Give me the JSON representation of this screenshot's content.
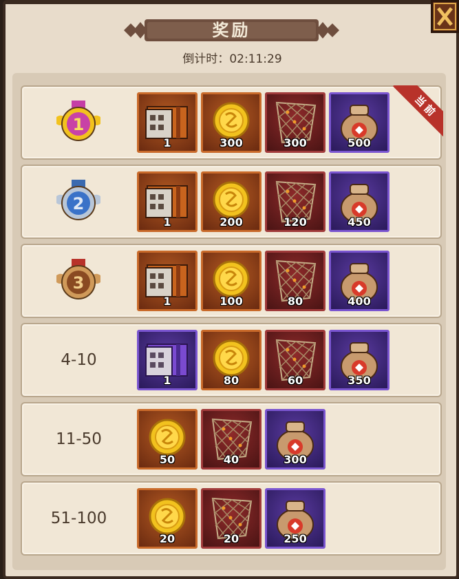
{
  "title": "奖励",
  "countdown": {
    "label": "倒计时：",
    "time": "02:11:29"
  },
  "current_badge": "当前",
  "rows": [
    {
      "rank_label": "",
      "medal": "gold-medal-1",
      "items": [
        {
          "icon": "treasure-chest-icon",
          "qty": "1",
          "frame": "orange"
        },
        {
          "icon": "gold-coin-icon",
          "qty": "300",
          "frame": "orange"
        },
        {
          "icon": "net-icon",
          "qty": "300",
          "frame": "red"
        },
        {
          "icon": "sack-icon",
          "qty": "500",
          "frame": "purple"
        }
      ]
    },
    {
      "rank_label": "",
      "medal": "silver-medal-2",
      "items": [
        {
          "icon": "treasure-chest-icon",
          "qty": "1",
          "frame": "orange"
        },
        {
          "icon": "gold-coin-icon",
          "qty": "200",
          "frame": "orange"
        },
        {
          "icon": "net-icon",
          "qty": "120",
          "frame": "red"
        },
        {
          "icon": "sack-icon",
          "qty": "450",
          "frame": "purple"
        }
      ]
    },
    {
      "rank_label": "",
      "medal": "bronze-medal-3",
      "items": [
        {
          "icon": "treasure-chest-icon",
          "qty": "1",
          "frame": "orange"
        },
        {
          "icon": "gold-coin-icon",
          "qty": "100",
          "frame": "orange"
        },
        {
          "icon": "net-icon",
          "qty": "80",
          "frame": "red"
        },
        {
          "icon": "sack-icon",
          "qty": "400",
          "frame": "purple"
        }
      ]
    },
    {
      "rank_label": "4-10",
      "medal": "",
      "items": [
        {
          "icon": "purple-chest-icon",
          "qty": "1",
          "frame": "purple"
        },
        {
          "icon": "gold-coin-icon",
          "qty": "80",
          "frame": "orange"
        },
        {
          "icon": "net-icon",
          "qty": "60",
          "frame": "red"
        },
        {
          "icon": "sack-icon",
          "qty": "350",
          "frame": "purple"
        }
      ]
    },
    {
      "rank_label": "11-50",
      "medal": "",
      "items": [
        {
          "icon": "gold-coin-icon",
          "qty": "50",
          "frame": "orange"
        },
        {
          "icon": "net-icon",
          "qty": "40",
          "frame": "red"
        },
        {
          "icon": "sack-icon",
          "qty": "300",
          "frame": "purple"
        }
      ]
    },
    {
      "rank_label": "51-100",
      "medal": "",
      "items": [
        {
          "icon": "gold-coin-icon",
          "qty": "20",
          "frame": "orange"
        },
        {
          "icon": "net-icon",
          "qty": "20",
          "frame": "red"
        },
        {
          "icon": "sack-icon",
          "qty": "250",
          "frame": "purple"
        }
      ]
    }
  ],
  "colors": {
    "panel": "#e8dccb",
    "row": "#f1e7d6",
    "ribbon": "#b8322a",
    "title_banner": "#6e4e3e"
  }
}
